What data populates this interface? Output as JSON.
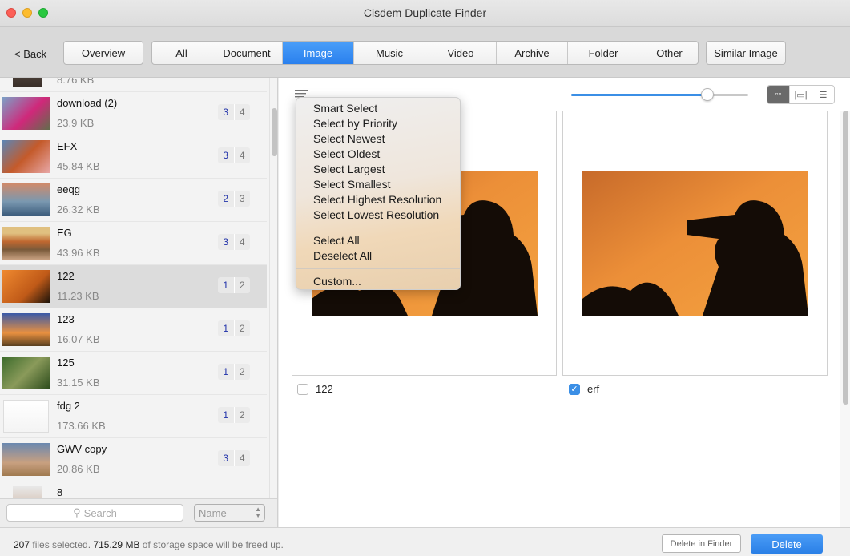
{
  "window": {
    "title": "Cisdem Duplicate Finder"
  },
  "toolbar": {
    "back_label": "< Back",
    "overview_label": "Overview",
    "tabs": [
      {
        "label": "All",
        "active": false
      },
      {
        "label": "Document",
        "active": false
      },
      {
        "label": "Image",
        "active": true
      },
      {
        "label": "Music",
        "active": false
      },
      {
        "label": "Video",
        "active": false
      },
      {
        "label": "Archive",
        "active": false
      },
      {
        "label": "Folder",
        "active": false
      },
      {
        "label": "Other",
        "active": false
      }
    ],
    "similar_image_label": "Similar Image"
  },
  "sidebar": {
    "items": [
      {
        "name": "",
        "size": "8.76 KB",
        "selected_count": "",
        "total_count": "",
        "selected": false
      },
      {
        "name": "download (2)",
        "size": "23.9 KB",
        "selected_count": "3",
        "total_count": "4",
        "selected": false
      },
      {
        "name": "EFX",
        "size": "45.84 KB",
        "selected_count": "3",
        "total_count": "4",
        "selected": false
      },
      {
        "name": "eeqg",
        "size": "26.32 KB",
        "selected_count": "2",
        "total_count": "3",
        "selected": false
      },
      {
        "name": "EG",
        "size": "43.96 KB",
        "selected_count": "3",
        "total_count": "4",
        "selected": false
      },
      {
        "name": "122",
        "size": "11.23 KB",
        "selected_count": "1",
        "total_count": "2",
        "selected": true
      },
      {
        "name": "123",
        "size": "16.07 KB",
        "selected_count": "1",
        "total_count": "2",
        "selected": false
      },
      {
        "name": "125",
        "size": "31.15 KB",
        "selected_count": "1",
        "total_count": "2",
        "selected": false
      },
      {
        "name": "fdg 2",
        "size": "173.66 KB",
        "selected_count": "1",
        "total_count": "2",
        "selected": false
      },
      {
        "name": "GWV copy",
        "size": "20.86 KB",
        "selected_count": "3",
        "total_count": "4",
        "selected": false
      },
      {
        "name": "8",
        "size": "",
        "selected_count": "",
        "total_count": "",
        "selected": false
      }
    ],
    "search_placeholder": "Search",
    "sort_value": "Name"
  },
  "main": {
    "zoom_slider_value": 0.77,
    "view_modes": [
      {
        "icon": "grid-view-icon",
        "active": true
      },
      {
        "icon": "filmstrip-view-icon",
        "active": false
      },
      {
        "icon": "list-view-icon",
        "active": false
      }
    ],
    "cards": [
      {
        "label": "122",
        "checked": false
      },
      {
        "label": "erf",
        "checked": true
      }
    ]
  },
  "select_menu": {
    "groups": [
      [
        "Smart Select",
        "Select by Priority",
        "Select Newest",
        "Select Oldest",
        "Select Largest",
        "Select Smallest",
        "Select Highest Resolution",
        "Select Lowest Resolution"
      ],
      [
        "Select All",
        "Deselect All"
      ],
      [
        "Custom..."
      ]
    ]
  },
  "statusbar": {
    "files_count": "207",
    "files_text": " files selected. ",
    "size": "715.29 MB",
    "size_text": " of storage space will be freed up.",
    "delete_in_finder_label": "Delete in Finder",
    "delete_label": "Delete"
  },
  "colors": {
    "accent": "#2f86ec",
    "badge_selected": "#2233aa"
  }
}
